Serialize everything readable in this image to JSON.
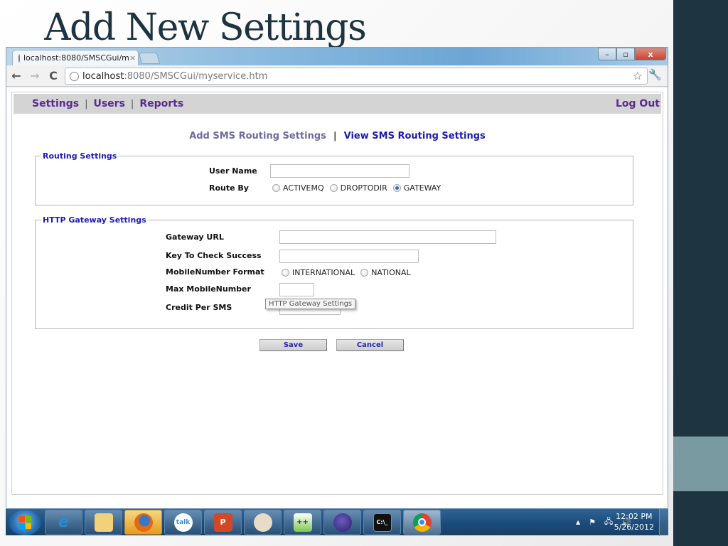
{
  "slide": {
    "title": "Add New Settings"
  },
  "browser": {
    "tab_title": "localhost:8080/SMSCGui/m",
    "tab_close": "×",
    "url_host": "localhost",
    "url_rest": ":8080/SMSCGui/myservice.htm",
    "nav": {
      "back": "←",
      "forward": "→",
      "reload": "C"
    },
    "window_controls": {
      "minimize": "–",
      "maximize": "▫",
      "close": "x"
    },
    "star": "☆",
    "wrench": "🔧"
  },
  "app": {
    "menu": {
      "items": [
        "Settings",
        "Users",
        "Reports"
      ],
      "separator": "|",
      "logout": "Log Out"
    },
    "subnav": {
      "add": "Add SMS Routing Settings",
      "separator": "|",
      "view": "View SMS Routing Settings"
    },
    "routing": {
      "legend": "Routing Settings",
      "user_name_label": "User Name",
      "user_name_value": "",
      "route_by_label": "Route By",
      "route_by_options": [
        "ACTIVEMQ",
        "DROPTODIR",
        "GATEWAY"
      ],
      "route_by_selected": "GATEWAY"
    },
    "gateway": {
      "legend": "HTTP Gateway Settings",
      "gateway_url_label": "Gateway URL",
      "gateway_url_value": "",
      "key_label": "Key To Check Success",
      "key_value": "",
      "format_label": "MobileNumber Format",
      "format_options": [
        "INTERNATIONAL",
        "NATIONAL"
      ],
      "format_selected": "",
      "max_label": "Max MobileNumber",
      "max_value": "",
      "credit_label": "Credit Per SMS",
      "credit_value": "",
      "tooltip": "HTTP Gateway Settings"
    },
    "buttons": {
      "save": "Save",
      "cancel": "Cancel"
    }
  },
  "taskbar": {
    "apps": [
      {
        "name": "internet-explorer",
        "glyph": "e"
      },
      {
        "name": "windows-explorer",
        "glyph": "📁"
      },
      {
        "name": "firefox",
        "glyph": "🦊"
      },
      {
        "name": "google-talk",
        "glyph": "talk"
      },
      {
        "name": "powerpoint",
        "glyph": "P"
      },
      {
        "name": "paint",
        "glyph": "🎨"
      },
      {
        "name": "notepad-plus-plus",
        "glyph": "++"
      },
      {
        "name": "eclipse",
        "glyph": "◉"
      },
      {
        "name": "command-prompt",
        "glyph": "C:\\_"
      },
      {
        "name": "chrome",
        "glyph": "◎"
      }
    ],
    "tray": {
      "show_hidden": "▲",
      "flag": "⚑",
      "network": "🖧",
      "volume": "🔊"
    },
    "clock": {
      "time": "12:02 PM",
      "date": "5/26/2012"
    }
  }
}
